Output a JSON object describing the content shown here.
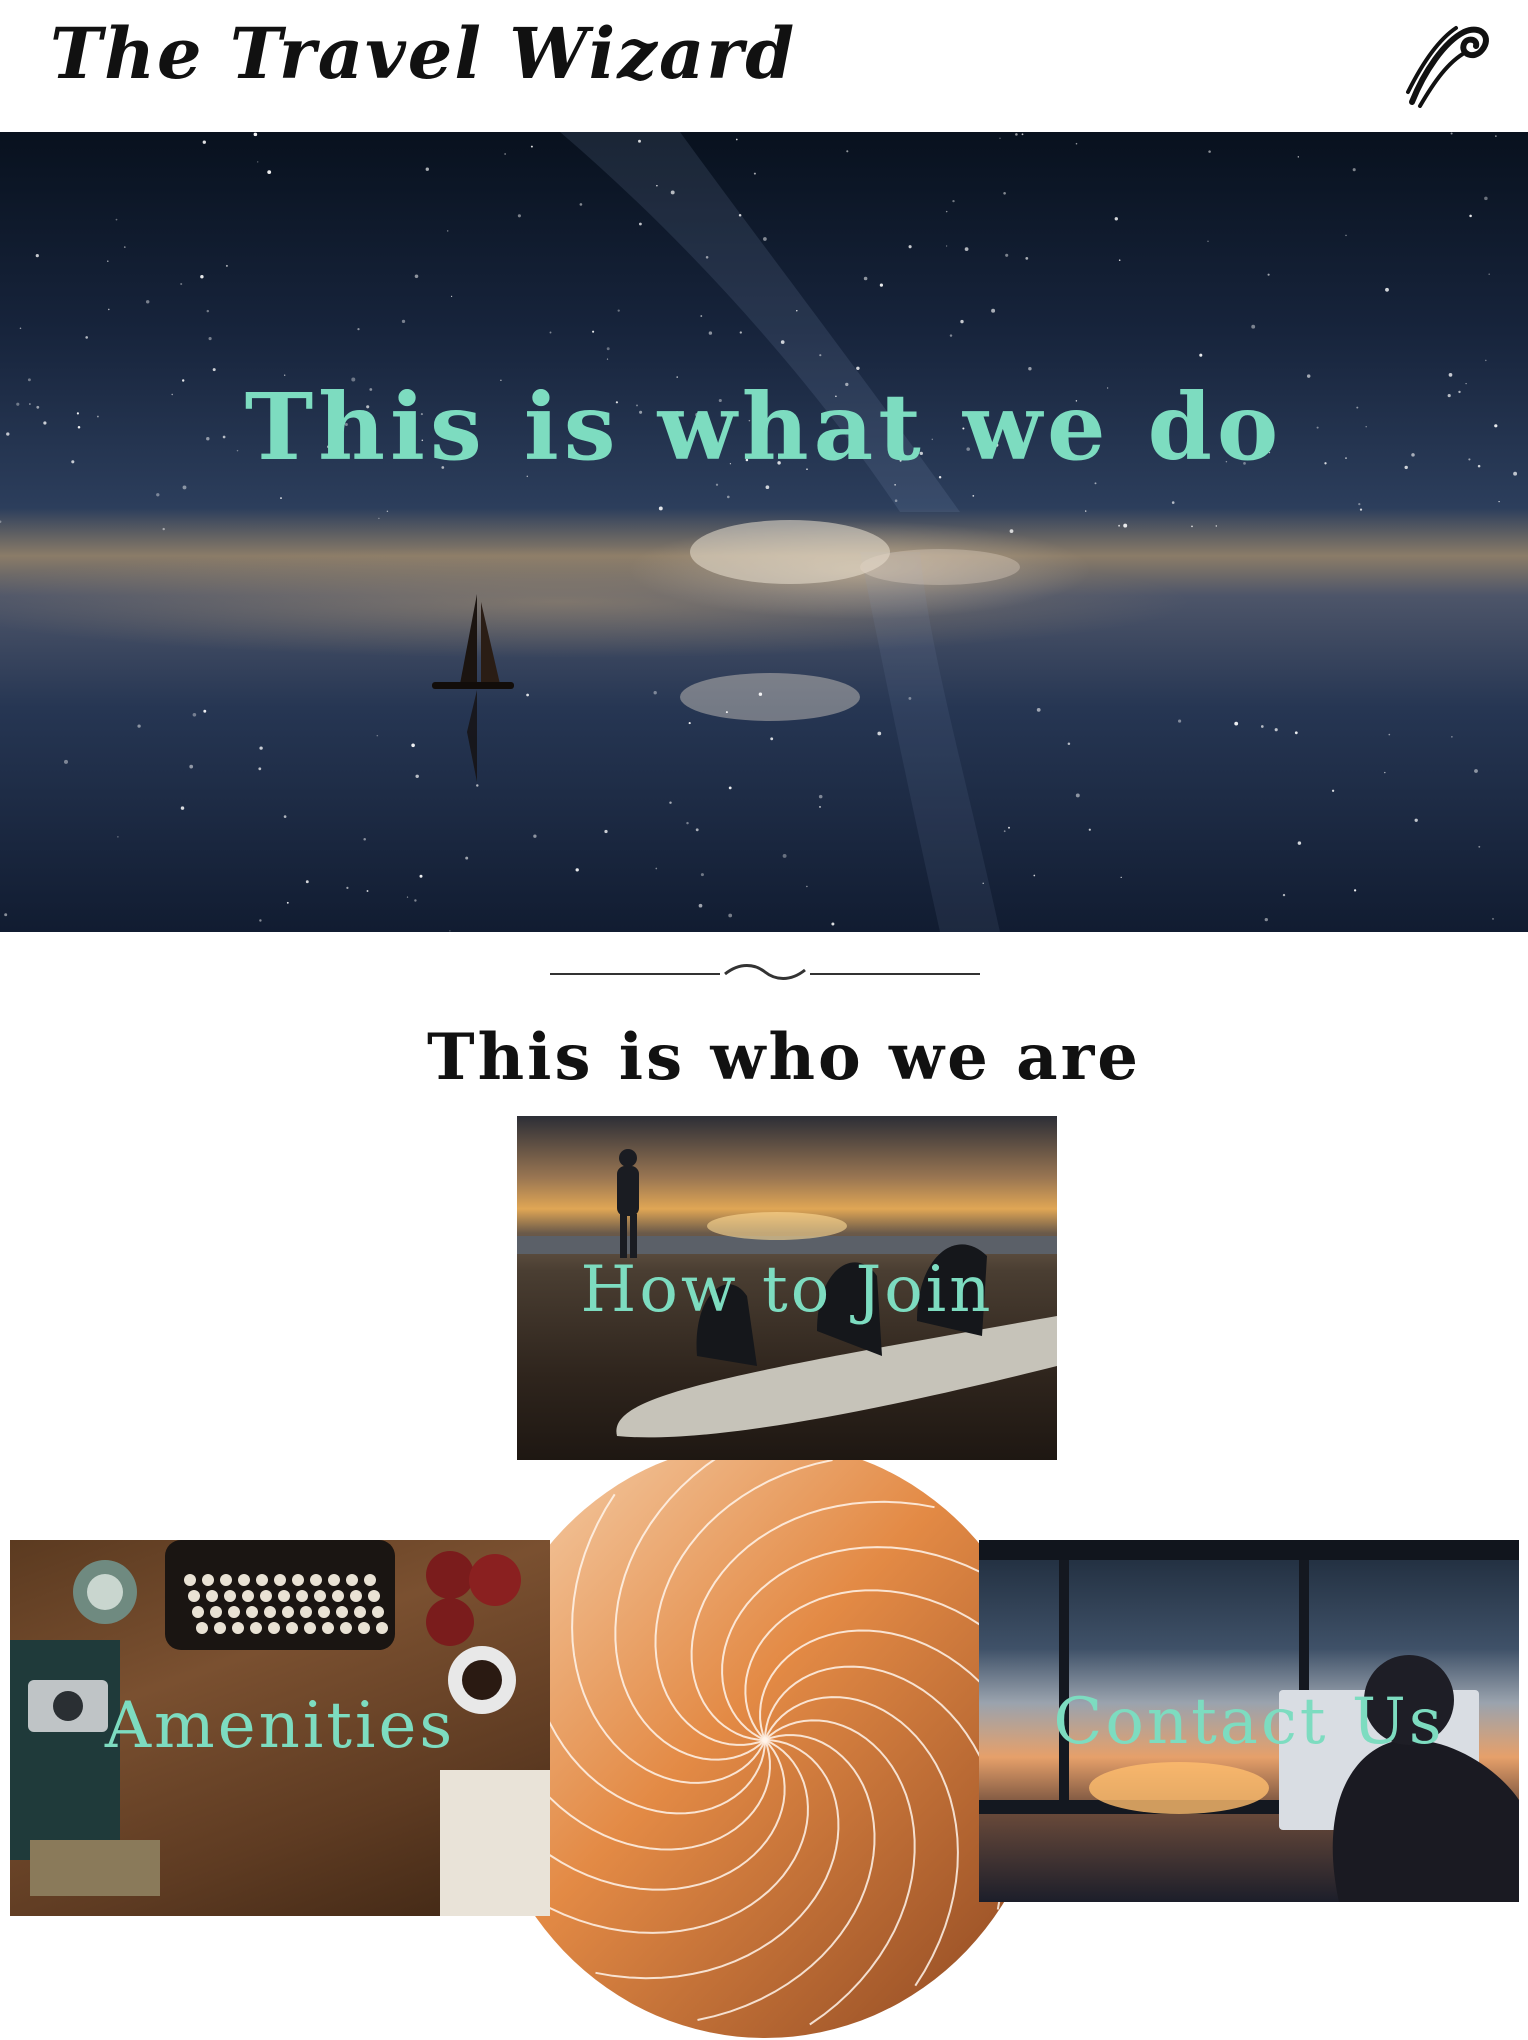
{
  "header": {
    "site_title": "The Travel Wizard",
    "logo_icon": "swirl-logo-icon"
  },
  "hero": {
    "heading": "This is what we do",
    "heading_color": "#7ddcc0",
    "image": "night-sky-sailboat-reflection"
  },
  "about": {
    "divider_icon": "flourish-divider-icon",
    "heading": "This is who we are"
  },
  "cards": {
    "how_to_join": {
      "label": "How to Join",
      "image": "surfboard-beach-sunset"
    },
    "amenities": {
      "label": "Amenities",
      "image": "typewriter-desk"
    },
    "contact_us": {
      "label": "Contact Us",
      "image": "person-at-window-sunset"
    }
  },
  "decor": {
    "spiral_icon": "orange-spiral-graphic",
    "spiral_color": "#e8944a"
  }
}
